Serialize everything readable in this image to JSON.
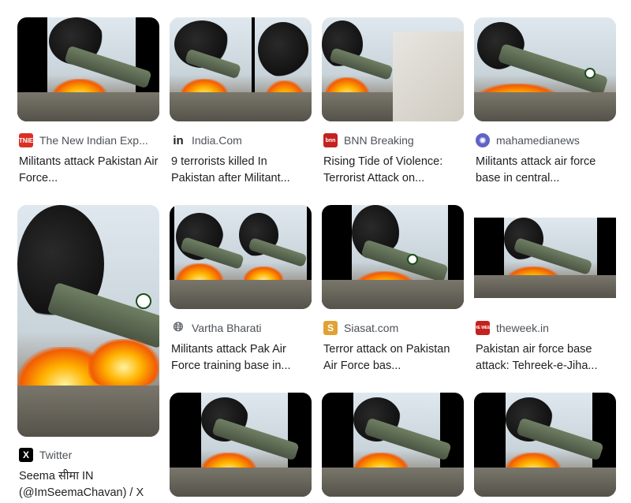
{
  "results": [
    {
      "source": "The New Indian Exp...",
      "favicon": "TNIE",
      "favicon_color": "#d93025",
      "title": "Militants attack Pakistan Air Force..."
    },
    {
      "source": "India.Com",
      "favicon": "in",
      "favicon_color": "#202124",
      "title": "9 terrorists killed In Pakistan after Militant..."
    },
    {
      "source": "BNN Breaking",
      "favicon": "bnn",
      "favicon_color": "#c5221f",
      "title": "Rising Tide of Violence: Terrorist Attack on..."
    },
    {
      "source": "mahamedianews",
      "favicon": "globe",
      "favicon_color": "#5f63c7",
      "title": "Militants attack air force base in central..."
    },
    {
      "source": "Twitter",
      "favicon": "X",
      "favicon_color": "#000000",
      "title": "Seema सीमा IN (@ImSeemaChavan) / X"
    },
    {
      "source": "Vartha Bharati",
      "favicon": "globe",
      "favicon_color": "#5f6368",
      "title": "Militants attack Pak Air Force training base in..."
    },
    {
      "source": "Siasat.com",
      "favicon": "S",
      "favicon_color": "#e0a233",
      "title": "Terror attack on Pakistan Air Force bas..."
    },
    {
      "source": "theweek.in",
      "favicon": "THE WEEK",
      "favicon_color": "#c5221f",
      "title": "Pakistan air force base attack: Tehreek-e-Jiha..."
    }
  ]
}
